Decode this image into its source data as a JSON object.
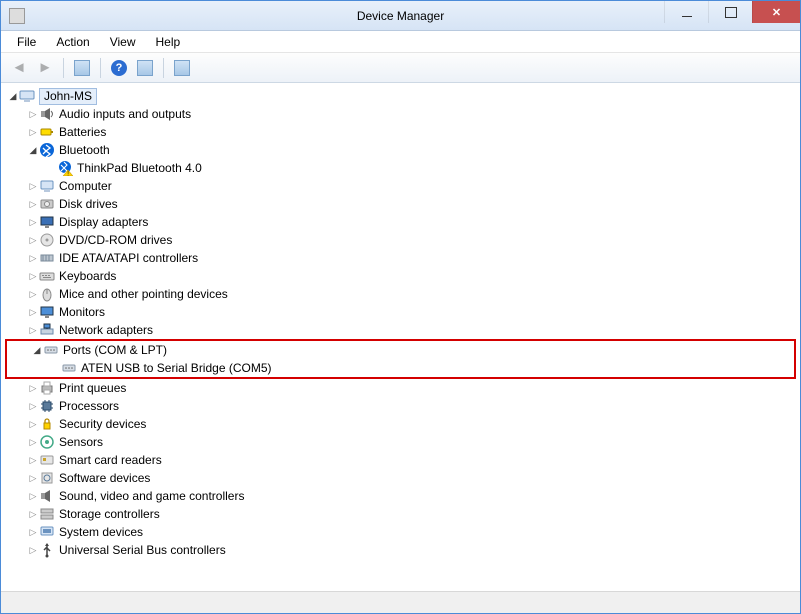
{
  "window": {
    "title": "Device Manager"
  },
  "menubar": {
    "file": "File",
    "action": "Action",
    "view": "View",
    "help": "Help"
  },
  "toolbar": {
    "back": "Back",
    "forward": "Forward",
    "show_hidden": "Show hidden devices",
    "help": "?",
    "properties": "Properties",
    "scan": "Scan for hardware changes"
  },
  "tree": {
    "root": "John-MS",
    "items": [
      {
        "label": "Audio inputs and outputs",
        "icon": "audio",
        "expanded": false
      },
      {
        "label": "Batteries",
        "icon": "battery",
        "expanded": false
      },
      {
        "label": "Bluetooth",
        "icon": "bluetooth",
        "expanded": true,
        "children": [
          {
            "label": "ThinkPad Bluetooth 4.0",
            "icon": "bluetooth-warn"
          }
        ]
      },
      {
        "label": "Computer",
        "icon": "computer",
        "expanded": false
      },
      {
        "label": "Disk drives",
        "icon": "disk",
        "expanded": false
      },
      {
        "label": "Display adapters",
        "icon": "display",
        "expanded": false
      },
      {
        "label": "DVD/CD-ROM drives",
        "icon": "optical",
        "expanded": false
      },
      {
        "label": "IDE ATA/ATAPI controllers",
        "icon": "ide",
        "expanded": false
      },
      {
        "label": "Keyboards",
        "icon": "keyboard",
        "expanded": false
      },
      {
        "label": "Mice and other pointing devices",
        "icon": "mouse",
        "expanded": false
      },
      {
        "label": "Monitors",
        "icon": "monitor",
        "expanded": false
      },
      {
        "label": "Network adapters",
        "icon": "network",
        "expanded": false
      },
      {
        "label": "Ports (COM & LPT)",
        "icon": "port",
        "expanded": true,
        "highlight": true,
        "children": [
          {
            "label": "ATEN USB to Serial Bridge (COM5)",
            "icon": "port"
          }
        ]
      },
      {
        "label": "Print queues",
        "icon": "printer",
        "expanded": false
      },
      {
        "label": "Processors",
        "icon": "cpu",
        "expanded": false
      },
      {
        "label": "Security devices",
        "icon": "security",
        "expanded": false
      },
      {
        "label": "Sensors",
        "icon": "sensor",
        "expanded": false
      },
      {
        "label": "Smart card readers",
        "icon": "smartcard",
        "expanded": false
      },
      {
        "label": "Software devices",
        "icon": "software",
        "expanded": false
      },
      {
        "label": "Sound, video and game controllers",
        "icon": "sound",
        "expanded": false
      },
      {
        "label": "Storage controllers",
        "icon": "storage",
        "expanded": false
      },
      {
        "label": "System devices",
        "icon": "system",
        "expanded": false
      },
      {
        "label": "Universal Serial Bus controllers",
        "icon": "usb",
        "expanded": false
      }
    ]
  }
}
